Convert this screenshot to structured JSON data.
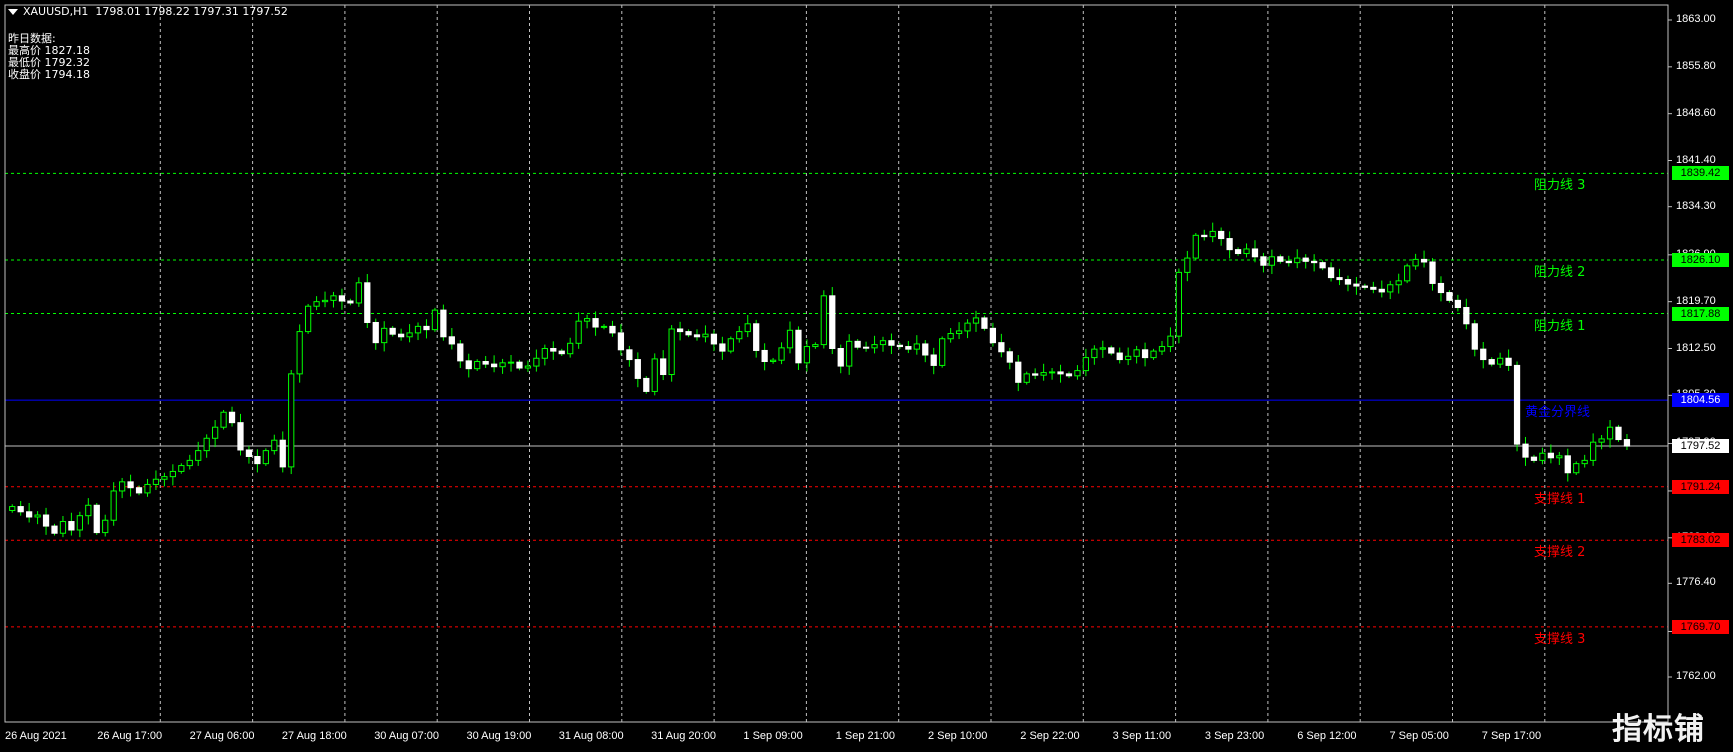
{
  "header": {
    "symbol": "XAUUSD,H1",
    "open": "1798.01",
    "high": "1798.22",
    "low": "1797.31",
    "close": "1797.52"
  },
  "info_panel": {
    "title": "昨日数据:",
    "high_label": "最高价",
    "high_value": "1827.18",
    "low_label": "最低价",
    "low_value": "1792.32",
    "close_label": "收盘价",
    "close_value": "1794.18"
  },
  "colors": {
    "background": "#000000",
    "bull_candle": "#ffffff",
    "wick": "#00ff00",
    "resistance": "#00ff00",
    "support": "#ff0000",
    "pivot": "#0000ff",
    "current_price": "#c0c0c0",
    "grid": "#c0c0c0"
  },
  "levels": [
    {
      "name": "阻力线 3",
      "price": 1839.42,
      "type": "resistance"
    },
    {
      "name": "阻力线 2",
      "price": 1826.1,
      "type": "resistance"
    },
    {
      "name": "阻力线 1",
      "price": 1817.88,
      "type": "resistance"
    },
    {
      "name": "黄金分界线",
      "price": 1804.56,
      "type": "pivot"
    },
    {
      "name": "支撑线 1",
      "price": 1791.24,
      "type": "support"
    },
    {
      "name": "支撑线 2",
      "price": 1783.02,
      "type": "support"
    },
    {
      "name": "支撑线 3",
      "price": 1769.7,
      "type": "support"
    }
  ],
  "level_tags": [
    "1839.42",
    "1826.10",
    "1817.88",
    "1804.56",
    "1791.24",
    "1783.02",
    "1769.70"
  ],
  "current_price": {
    "value": 1797.52,
    "label": "1797.52"
  },
  "chart_data": {
    "type": "candlestick",
    "symbol": "XAUUSD",
    "timeframe": "H1",
    "ylim": [
      1760,
      1865
    ],
    "y_ticks": [
      "1863.00",
      "1855.80",
      "1848.60",
      "1841.40",
      "1834.30",
      "1826.90",
      "1819.70",
      "1812.50",
      "1805.30",
      "1797.90",
      "1790.60",
      "1783.40",
      "1776.40",
      "1769.00",
      "1762.00"
    ],
    "x_ticks": [
      "26 Aug 2021",
      "26 Aug 17:00",
      "27 Aug 06:00",
      "27 Aug 18:00",
      "30 Aug 07:00",
      "30 Aug 19:00",
      "31 Aug 08:00",
      "31 Aug 20:00",
      "1 Sep 09:00",
      "1 Sep 21:00",
      "2 Sep 10:00",
      "2 Sep 22:00",
      "3 Sep 11:00",
      "3 Sep 23:00",
      "6 Sep 12:00",
      "7 Sep 05:00",
      "7 Sep 17:00"
    ],
    "closes": [
      1788.2,
      1787.4,
      1786.6,
      1786.9,
      1785.2,
      1784.1,
      1785.9,
      1784.6,
      1786.8,
      1788.4,
      1784.2,
      1786.1,
      1790.6,
      1792.0,
      1791.1,
      1790.3,
      1791.6,
      1792.4,
      1792.8,
      1793.6,
      1794.5,
      1795.3,
      1796.8,
      1798.7,
      1800.4,
      1802.7,
      1801.1,
      1796.9,
      1795.9,
      1794.8,
      1796.8,
      1798.4,
      1794.3,
      1808.6,
      1815.1,
      1819.0,
      1819.7,
      1819.9,
      1820.6,
      1819.8,
      1819.5,
      1822.6,
      1816.5,
      1813.4,
      1815.6,
      1814.7,
      1814.3,
      1814.9,
      1815.9,
      1815.4,
      1818.4,
      1814.3,
      1813.2,
      1810.6,
      1809.4,
      1810.5,
      1810.1,
      1809.7,
      1810.3,
      1810.4,
      1809.5,
      1809.8,
      1811.0,
      1812.5,
      1812.1,
      1811.7,
      1813.3,
      1816.7,
      1817.1,
      1815.8,
      1815.9,
      1814.9,
      1812.3,
      1810.8,
      1807.9,
      1805.9,
      1810.9,
      1808.5,
      1815.5,
      1815.1,
      1814.6,
      1814.3,
      1814.7,
      1813.2,
      1812.1,
      1814.0,
      1815.1,
      1816.3,
      1812.2,
      1810.5,
      1810.7,
      1812.6,
      1815.3,
      1810.3,
      1812.8,
      1813.1,
      1820.6,
      1812.5,
      1809.8,
      1813.6,
      1812.7,
      1812.6,
      1813.1,
      1813.7,
      1813.0,
      1812.8,
      1812.4,
      1813.2,
      1811.5,
      1809.9,
      1814.0,
      1814.8,
      1815.2,
      1816.4,
      1817.2,
      1815.6,
      1813.4,
      1812.0,
      1810.4,
      1807.3,
      1808.6,
      1808.4,
      1808.8,
      1808.9,
      1808.6,
      1808.3,
      1809.1,
      1811.1,
      1812.4,
      1812.6,
      1811.8,
      1810.8,
      1811.3,
      1812.3,
      1811.1,
      1812.1,
      1812.8,
      1814.4,
      1824.2,
      1826.4,
      1829.9,
      1829.7,
      1830.5,
      1829.4,
      1827.7,
      1827.1,
      1827.8,
      1826.6,
      1825.3,
      1826.6,
      1825.9,
      1825.7,
      1826.4,
      1825.9,
      1825.7,
      1824.9,
      1823.4,
      1823.1,
      1822.4,
      1822.1,
      1821.9,
      1821.6,
      1821.2,
      1822.3,
      1822.9,
      1825.2,
      1826.2,
      1825.8,
      1822.5,
      1821.1,
      1819.9,
      1818.8,
      1816.3,
      1812.4,
      1810.8,
      1810.1,
      1811.0,
      1809.9,
      1797.8,
      1795.8,
      1795.3,
      1796.4,
      1795.7,
      1796.0,
      1793.4,
      1794.8,
      1795.3,
      1798.1,
      1798.6,
      1800.4,
      1798.5,
      1797.5
    ]
  },
  "watermark": "指标铺"
}
